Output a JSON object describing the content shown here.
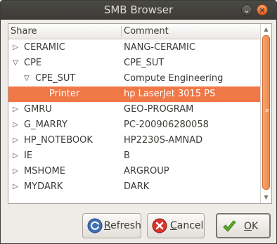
{
  "window": {
    "title": "SMB Browser"
  },
  "columns": {
    "share": "Share",
    "comment": "Comment"
  },
  "rows": [
    {
      "share": "CERAMIC",
      "comment": "NANG-CERAMIC",
      "expander": "collapsed",
      "level": 0
    },
    {
      "share": "CPE",
      "comment": "CPE_SUT",
      "expander": "expanded",
      "level": 0
    },
    {
      "share": "CPE_SUT",
      "comment": "Compute Engineering",
      "expander": "expanded",
      "level": 1
    },
    {
      "share": "Printer",
      "comment": "hp LaserJet 3015 PS",
      "expander": "none",
      "level": 2,
      "selected": true
    },
    {
      "share": "GMRU",
      "comment": "GEO-PROGRAM",
      "expander": "collapsed",
      "level": 0
    },
    {
      "share": "G_MARRY",
      "comment": "PC-200906280058",
      "expander": "collapsed",
      "level": 0
    },
    {
      "share": "HP_NOTEBOOK",
      "comment": "HP2230S-AMNAD",
      "expander": "collapsed",
      "level": 0
    },
    {
      "share": "IE",
      "comment": "B",
      "expander": "collapsed",
      "level": 0
    },
    {
      "share": "MSHOME",
      "comment": "ARGROUP",
      "expander": "collapsed",
      "level": 0
    },
    {
      "share": "MYDARK",
      "comment": "DARK",
      "expander": "collapsed",
      "level": 0
    }
  ],
  "buttons": {
    "refresh": {
      "mnemonic": "R",
      "rest": "efresh",
      "icon": "refresh-icon"
    },
    "cancel": {
      "mnemonic": "C",
      "rest": "ancel",
      "icon": "cancel-icon"
    },
    "ok": {
      "mnemonic": "O",
      "rest": "K",
      "icon": "checkmark-icon"
    }
  },
  "colors": {
    "selection": "#f07746",
    "titlebar": "#3c3b37",
    "accent": "#f08a4c"
  }
}
